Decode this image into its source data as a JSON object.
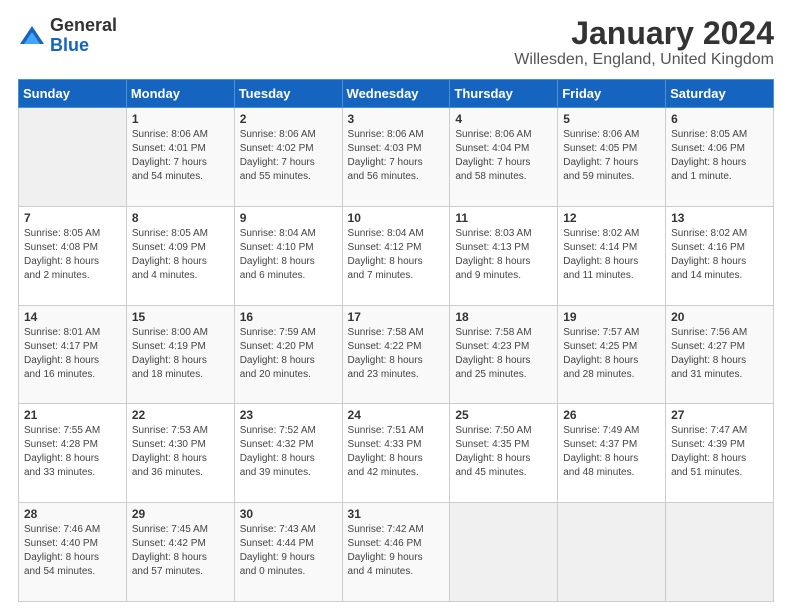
{
  "header": {
    "logo_general": "General",
    "logo_blue": "Blue",
    "main_title": "January 2024",
    "sub_title": "Willesden, England, United Kingdom"
  },
  "days_of_week": [
    "Sunday",
    "Monday",
    "Tuesday",
    "Wednesday",
    "Thursday",
    "Friday",
    "Saturday"
  ],
  "weeks": [
    [
      {
        "day": "",
        "content": ""
      },
      {
        "day": "1",
        "content": "Sunrise: 8:06 AM\nSunset: 4:01 PM\nDaylight: 7 hours\nand 54 minutes."
      },
      {
        "day": "2",
        "content": "Sunrise: 8:06 AM\nSunset: 4:02 PM\nDaylight: 7 hours\nand 55 minutes."
      },
      {
        "day": "3",
        "content": "Sunrise: 8:06 AM\nSunset: 4:03 PM\nDaylight: 7 hours\nand 56 minutes."
      },
      {
        "day": "4",
        "content": "Sunrise: 8:06 AM\nSunset: 4:04 PM\nDaylight: 7 hours\nand 58 minutes."
      },
      {
        "day": "5",
        "content": "Sunrise: 8:06 AM\nSunset: 4:05 PM\nDaylight: 7 hours\nand 59 minutes."
      },
      {
        "day": "6",
        "content": "Sunrise: 8:05 AM\nSunset: 4:06 PM\nDaylight: 8 hours\nand 1 minute."
      }
    ],
    [
      {
        "day": "7",
        "content": "Sunrise: 8:05 AM\nSunset: 4:08 PM\nDaylight: 8 hours\nand 2 minutes."
      },
      {
        "day": "8",
        "content": "Sunrise: 8:05 AM\nSunset: 4:09 PM\nDaylight: 8 hours\nand 4 minutes."
      },
      {
        "day": "9",
        "content": "Sunrise: 8:04 AM\nSunset: 4:10 PM\nDaylight: 8 hours\nand 6 minutes."
      },
      {
        "day": "10",
        "content": "Sunrise: 8:04 AM\nSunset: 4:12 PM\nDaylight: 8 hours\nand 7 minutes."
      },
      {
        "day": "11",
        "content": "Sunrise: 8:03 AM\nSunset: 4:13 PM\nDaylight: 8 hours\nand 9 minutes."
      },
      {
        "day": "12",
        "content": "Sunrise: 8:02 AM\nSunset: 4:14 PM\nDaylight: 8 hours\nand 11 minutes."
      },
      {
        "day": "13",
        "content": "Sunrise: 8:02 AM\nSunset: 4:16 PM\nDaylight: 8 hours\nand 14 minutes."
      }
    ],
    [
      {
        "day": "14",
        "content": "Sunrise: 8:01 AM\nSunset: 4:17 PM\nDaylight: 8 hours\nand 16 minutes."
      },
      {
        "day": "15",
        "content": "Sunrise: 8:00 AM\nSunset: 4:19 PM\nDaylight: 8 hours\nand 18 minutes."
      },
      {
        "day": "16",
        "content": "Sunrise: 7:59 AM\nSunset: 4:20 PM\nDaylight: 8 hours\nand 20 minutes."
      },
      {
        "day": "17",
        "content": "Sunrise: 7:58 AM\nSunset: 4:22 PM\nDaylight: 8 hours\nand 23 minutes."
      },
      {
        "day": "18",
        "content": "Sunrise: 7:58 AM\nSunset: 4:23 PM\nDaylight: 8 hours\nand 25 minutes."
      },
      {
        "day": "19",
        "content": "Sunrise: 7:57 AM\nSunset: 4:25 PM\nDaylight: 8 hours\nand 28 minutes."
      },
      {
        "day": "20",
        "content": "Sunrise: 7:56 AM\nSunset: 4:27 PM\nDaylight: 8 hours\nand 31 minutes."
      }
    ],
    [
      {
        "day": "21",
        "content": "Sunrise: 7:55 AM\nSunset: 4:28 PM\nDaylight: 8 hours\nand 33 minutes."
      },
      {
        "day": "22",
        "content": "Sunrise: 7:53 AM\nSunset: 4:30 PM\nDaylight: 8 hours\nand 36 minutes."
      },
      {
        "day": "23",
        "content": "Sunrise: 7:52 AM\nSunset: 4:32 PM\nDaylight: 8 hours\nand 39 minutes."
      },
      {
        "day": "24",
        "content": "Sunrise: 7:51 AM\nSunset: 4:33 PM\nDaylight: 8 hours\nand 42 minutes."
      },
      {
        "day": "25",
        "content": "Sunrise: 7:50 AM\nSunset: 4:35 PM\nDaylight: 8 hours\nand 45 minutes."
      },
      {
        "day": "26",
        "content": "Sunrise: 7:49 AM\nSunset: 4:37 PM\nDaylight: 8 hours\nand 48 minutes."
      },
      {
        "day": "27",
        "content": "Sunrise: 7:47 AM\nSunset: 4:39 PM\nDaylight: 8 hours\nand 51 minutes."
      }
    ],
    [
      {
        "day": "28",
        "content": "Sunrise: 7:46 AM\nSunset: 4:40 PM\nDaylight: 8 hours\nand 54 minutes."
      },
      {
        "day": "29",
        "content": "Sunrise: 7:45 AM\nSunset: 4:42 PM\nDaylight: 8 hours\nand 57 minutes."
      },
      {
        "day": "30",
        "content": "Sunrise: 7:43 AM\nSunset: 4:44 PM\nDaylight: 9 hours\nand 0 minutes."
      },
      {
        "day": "31",
        "content": "Sunrise: 7:42 AM\nSunset: 4:46 PM\nDaylight: 9 hours\nand 4 minutes."
      },
      {
        "day": "",
        "content": ""
      },
      {
        "day": "",
        "content": ""
      },
      {
        "day": "",
        "content": ""
      }
    ]
  ]
}
